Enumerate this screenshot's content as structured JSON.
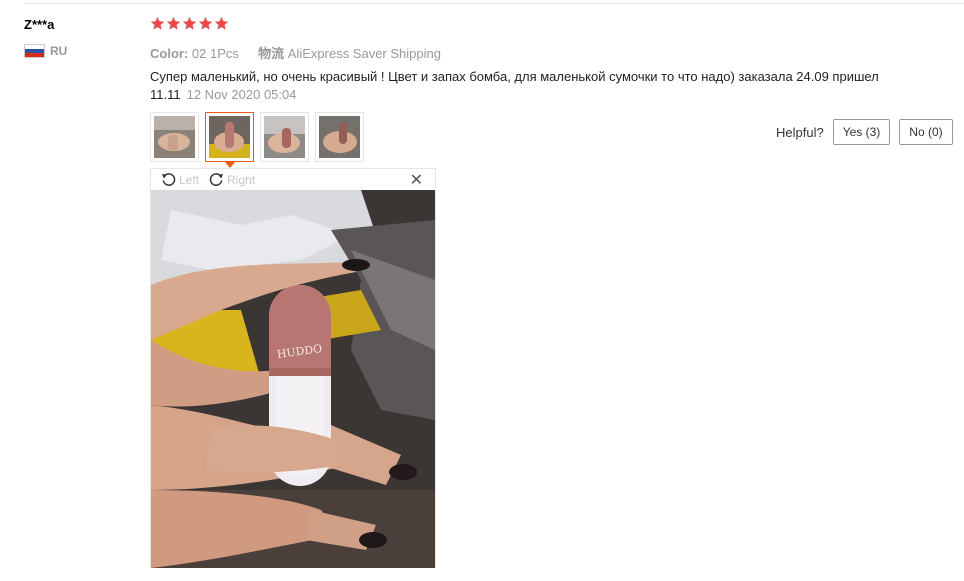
{
  "reviewer": {
    "name": "Z***a",
    "country": "RU",
    "flag_colors": [
      "#ffffff",
      "#2f4fa0",
      "#d52b1e"
    ]
  },
  "rating": {
    "stars": 5,
    "max": 5,
    "color": "#e84b4b"
  },
  "sku": {
    "color_label": "Color:",
    "color_value": "02 1Pcs",
    "shipping_label": "物流",
    "shipping_value": "AliExpress Saver Shipping"
  },
  "review": {
    "text": "Супер маленький, но очень красивый ! Цвет и запах бомба, для маленькой сумочки то что надо) заказала 24.09 пришел 11.11",
    "date": "12 Nov 2020 05:04"
  },
  "thumbnails": [
    {
      "name": "photo-1",
      "active": false
    },
    {
      "name": "photo-2",
      "active": true
    },
    {
      "name": "photo-3",
      "active": false
    },
    {
      "name": "photo-4",
      "active": false
    }
  ],
  "helpful": {
    "label": "Helpful?",
    "yes": "Yes (3)",
    "no": "No (0)"
  },
  "viewer": {
    "rotate_left": "Left",
    "rotate_right": "Right",
    "close": "✕",
    "icons": [
      "rotate-left-icon",
      "rotate-right-icon",
      "close-icon"
    ]
  },
  "colors": {
    "accent": "#f15a0e",
    "muted": "#999999"
  }
}
